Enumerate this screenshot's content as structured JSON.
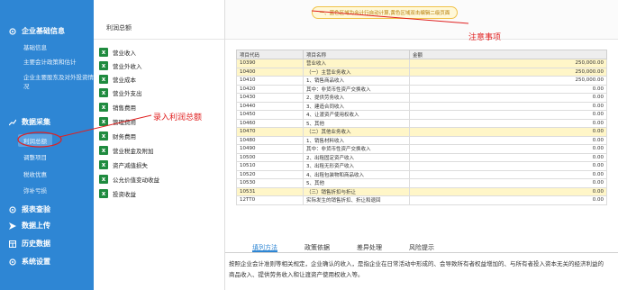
{
  "sidebar": {
    "sections": [
      {
        "label": "企业基础信息",
        "icon": "gear-icon"
      },
      {
        "label": "数据采集",
        "icon": "chart-icon"
      },
      {
        "label": "报表查验",
        "icon": "gear-icon"
      },
      {
        "label": "数据上传",
        "icon": "send-icon"
      },
      {
        "label": "历史数据",
        "icon": "table-icon"
      },
      {
        "label": "系统设置",
        "icon": "gear-icon"
      }
    ],
    "basic_items": [
      "基础信息",
      "主要会计政策和估计",
      "企业主要股东及对外投资情况"
    ],
    "collect_items": [
      "利润总额",
      "调整项目",
      "税收优惠",
      "弥补亏损"
    ]
  },
  "middle": {
    "title": "利润总额",
    "items": [
      "营业收入",
      "营业外收入",
      "营业成本",
      "营业外支出",
      "销售费用",
      "管理费用",
      "财务费用",
      "营业税金及附加",
      "资产减值损失",
      "公允价值变动收益",
      "投资收益"
    ]
  },
  "hint": "一、蓝色区域为会计行自动计算,黄色区域双击编辑二级页面",
  "annotations": {
    "note": "注意事项",
    "entry": "录入利润总额"
  },
  "table": {
    "headers": [
      "项目代码",
      "项目名称",
      "金额"
    ],
    "rows": [
      {
        "code": "10390",
        "name": "营业收入",
        "amount": "250,000.00",
        "hl": true
      },
      {
        "code": "10400",
        "name": "（一）主营业务收入",
        "amount": "250,000.00",
        "hl": true
      },
      {
        "code": "10410",
        "name": "1、销售商品收入",
        "amount": "250,000.00",
        "hl": false
      },
      {
        "code": "10420",
        "name": "其中：非货币性资产交换收入",
        "amount": "0.00",
        "hl": false
      },
      {
        "code": "10430",
        "name": "2、提供劳务收入",
        "amount": "0.00",
        "hl": false
      },
      {
        "code": "10440",
        "name": "3、建造合同收入",
        "amount": "0.00",
        "hl": false
      },
      {
        "code": "10450",
        "name": "4、让渡资产使用权收入",
        "amount": "0.00",
        "hl": false
      },
      {
        "code": "10460",
        "name": "5、其他",
        "amount": "0.00",
        "hl": false
      },
      {
        "code": "10470",
        "name": "（二）其他业务收入",
        "amount": "0.00",
        "hl": true
      },
      {
        "code": "10480",
        "name": "1、销售材料收入",
        "amount": "0.00",
        "hl": false
      },
      {
        "code": "10490",
        "name": "其中：非货币性资产交换收入",
        "amount": "0.00",
        "hl": false
      },
      {
        "code": "10500",
        "name": "2、出租固定资产收入",
        "amount": "0.00",
        "hl": false
      },
      {
        "code": "10510",
        "name": "3、出租无形资产收入",
        "amount": "0.00",
        "hl": false
      },
      {
        "code": "10520",
        "name": "4、出租包装物和商品收入",
        "amount": "0.00",
        "hl": false
      },
      {
        "code": "10530",
        "name": "5、其他",
        "amount": "0.00",
        "hl": false
      },
      {
        "code": "10531",
        "name": "（三）销售折扣与折让",
        "amount": "0.00",
        "hl": true
      },
      {
        "code": "12TT0",
        "name": "实际发生的销售折扣、折让和退回",
        "amount": "0.00",
        "hl": false
      }
    ]
  },
  "tabs": [
    "填列方法",
    "政策依据",
    "差异处理",
    "风险提示"
  ],
  "description": {
    "line1": "按照企业会计准则等相关规定，企业确认的收入，是指企业在日常活动中形成的、会导致所有者权益增加的、与所有者投入资本无关的经济利益的",
    "line2": "商品收入、提供劳务收入和让渡资产使用权收入等。"
  },
  "colors": {
    "sidebar": "#2e86d4",
    "excel": "#1f8b3f",
    "highlight": "#fff6c8",
    "annotation": "#e02020"
  }
}
